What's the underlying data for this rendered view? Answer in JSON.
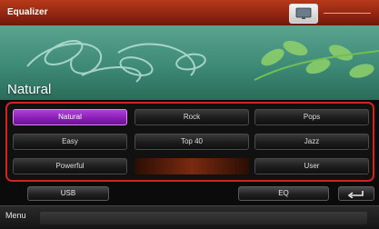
{
  "header": {
    "title": "Equalizer",
    "accent_color": "#9a2c14"
  },
  "hero": {
    "preset_name": "Natural"
  },
  "presets": {
    "items": [
      {
        "label": "Natural",
        "selected": true
      },
      {
        "label": "Rock",
        "selected": false
      },
      {
        "label": "Pops",
        "selected": false
      },
      {
        "label": "Easy",
        "selected": false
      },
      {
        "label": "Top 40",
        "selected": false
      },
      {
        "label": "Jazz",
        "selected": false
      },
      {
        "label": "Powerful",
        "selected": false
      },
      {
        "label": "",
        "selected": false
      },
      {
        "label": "User",
        "selected": false
      }
    ],
    "selected_color": "#9a2bc8",
    "highlight_border_color": "#d32222"
  },
  "controls": {
    "source_label": "USB",
    "eq_label": "EQ",
    "back_icon": "return-arrow-icon"
  },
  "footer": {
    "menu_label": "Menu"
  }
}
